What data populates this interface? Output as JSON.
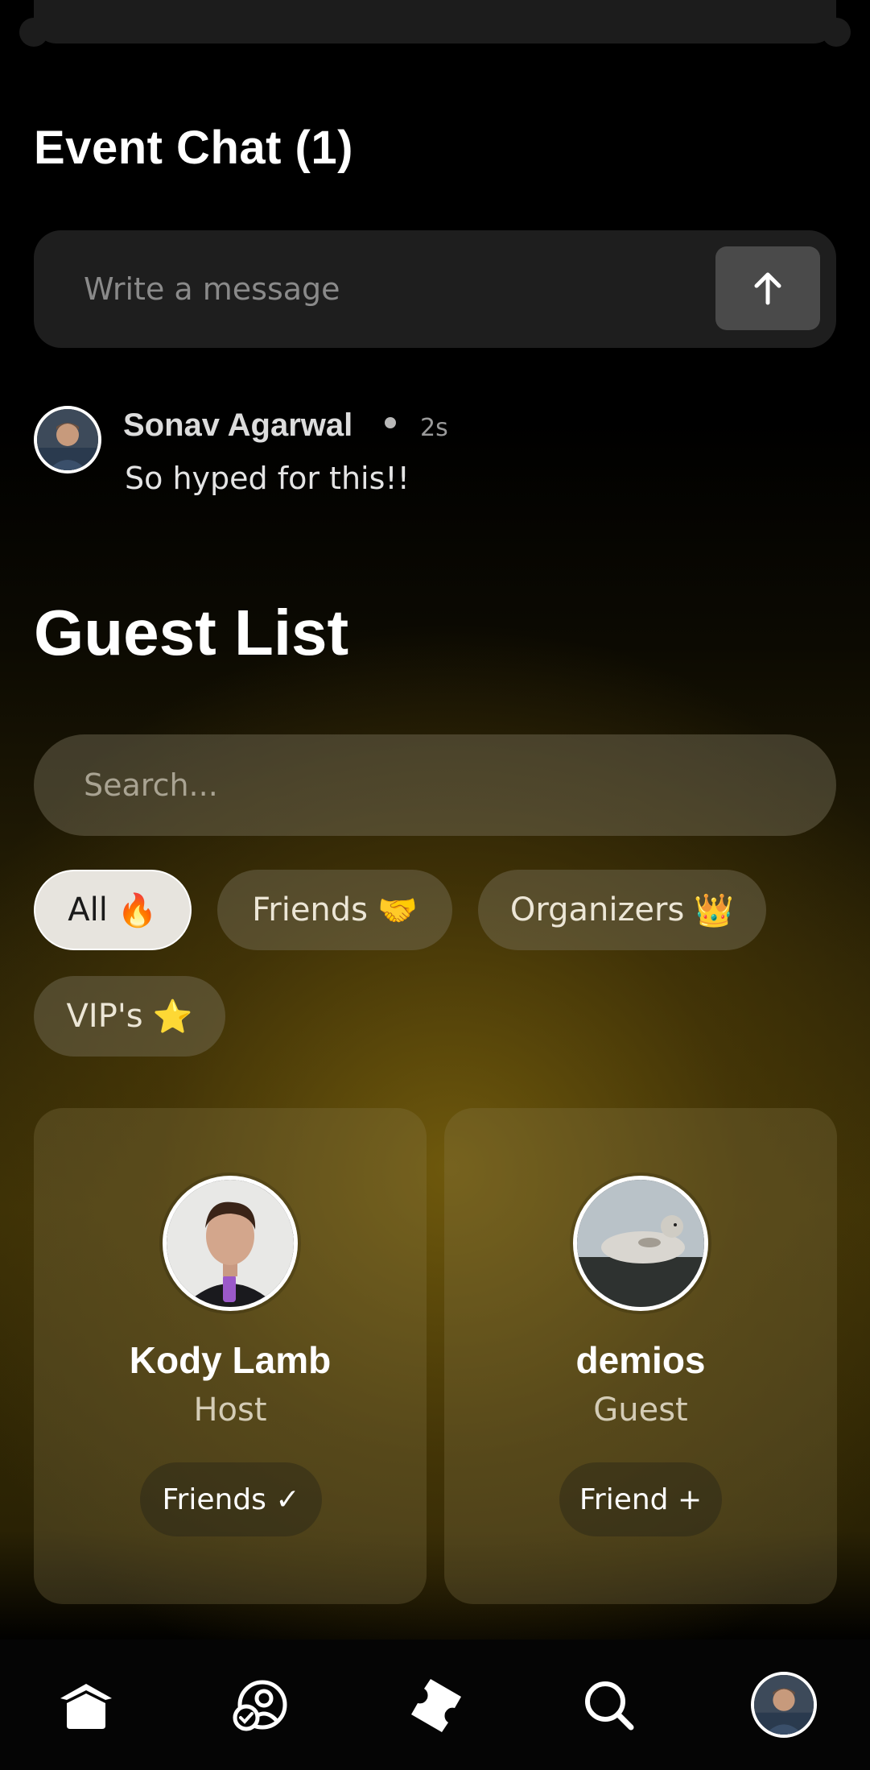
{
  "chat": {
    "title": "Event Chat (1)",
    "input_placeholder": "Write a message",
    "send_icon": "arrow-up-icon",
    "messages": [
      {
        "author": "Sonav Agarwal",
        "time": "2s",
        "text": "So hyped for this!!"
      }
    ]
  },
  "guests": {
    "title": "Guest List",
    "search_placeholder": "Search...",
    "filters": [
      {
        "label": "All",
        "emoji": "🔥",
        "active": true
      },
      {
        "label": "Friends",
        "emoji": "🤝",
        "active": false
      },
      {
        "label": "Organizers",
        "emoji": "👑",
        "active": false
      },
      {
        "label": "VIP's",
        "emoji": "⭐",
        "active": false
      }
    ],
    "cards": [
      {
        "name": "Kody Lamb",
        "role": "Host",
        "button": "Friends ✓"
      },
      {
        "name": "demios",
        "role": "Guest",
        "button": "Friend +"
      }
    ]
  },
  "tabbar": {
    "icons": [
      "home-icon",
      "friends-check-icon",
      "ticket-icon",
      "search-icon",
      "profile-avatar"
    ]
  },
  "colors": {
    "accent_gold": "#6b5a12",
    "chip_active_bg": "#e7e4de",
    "tabbar_bg": "#050505"
  }
}
